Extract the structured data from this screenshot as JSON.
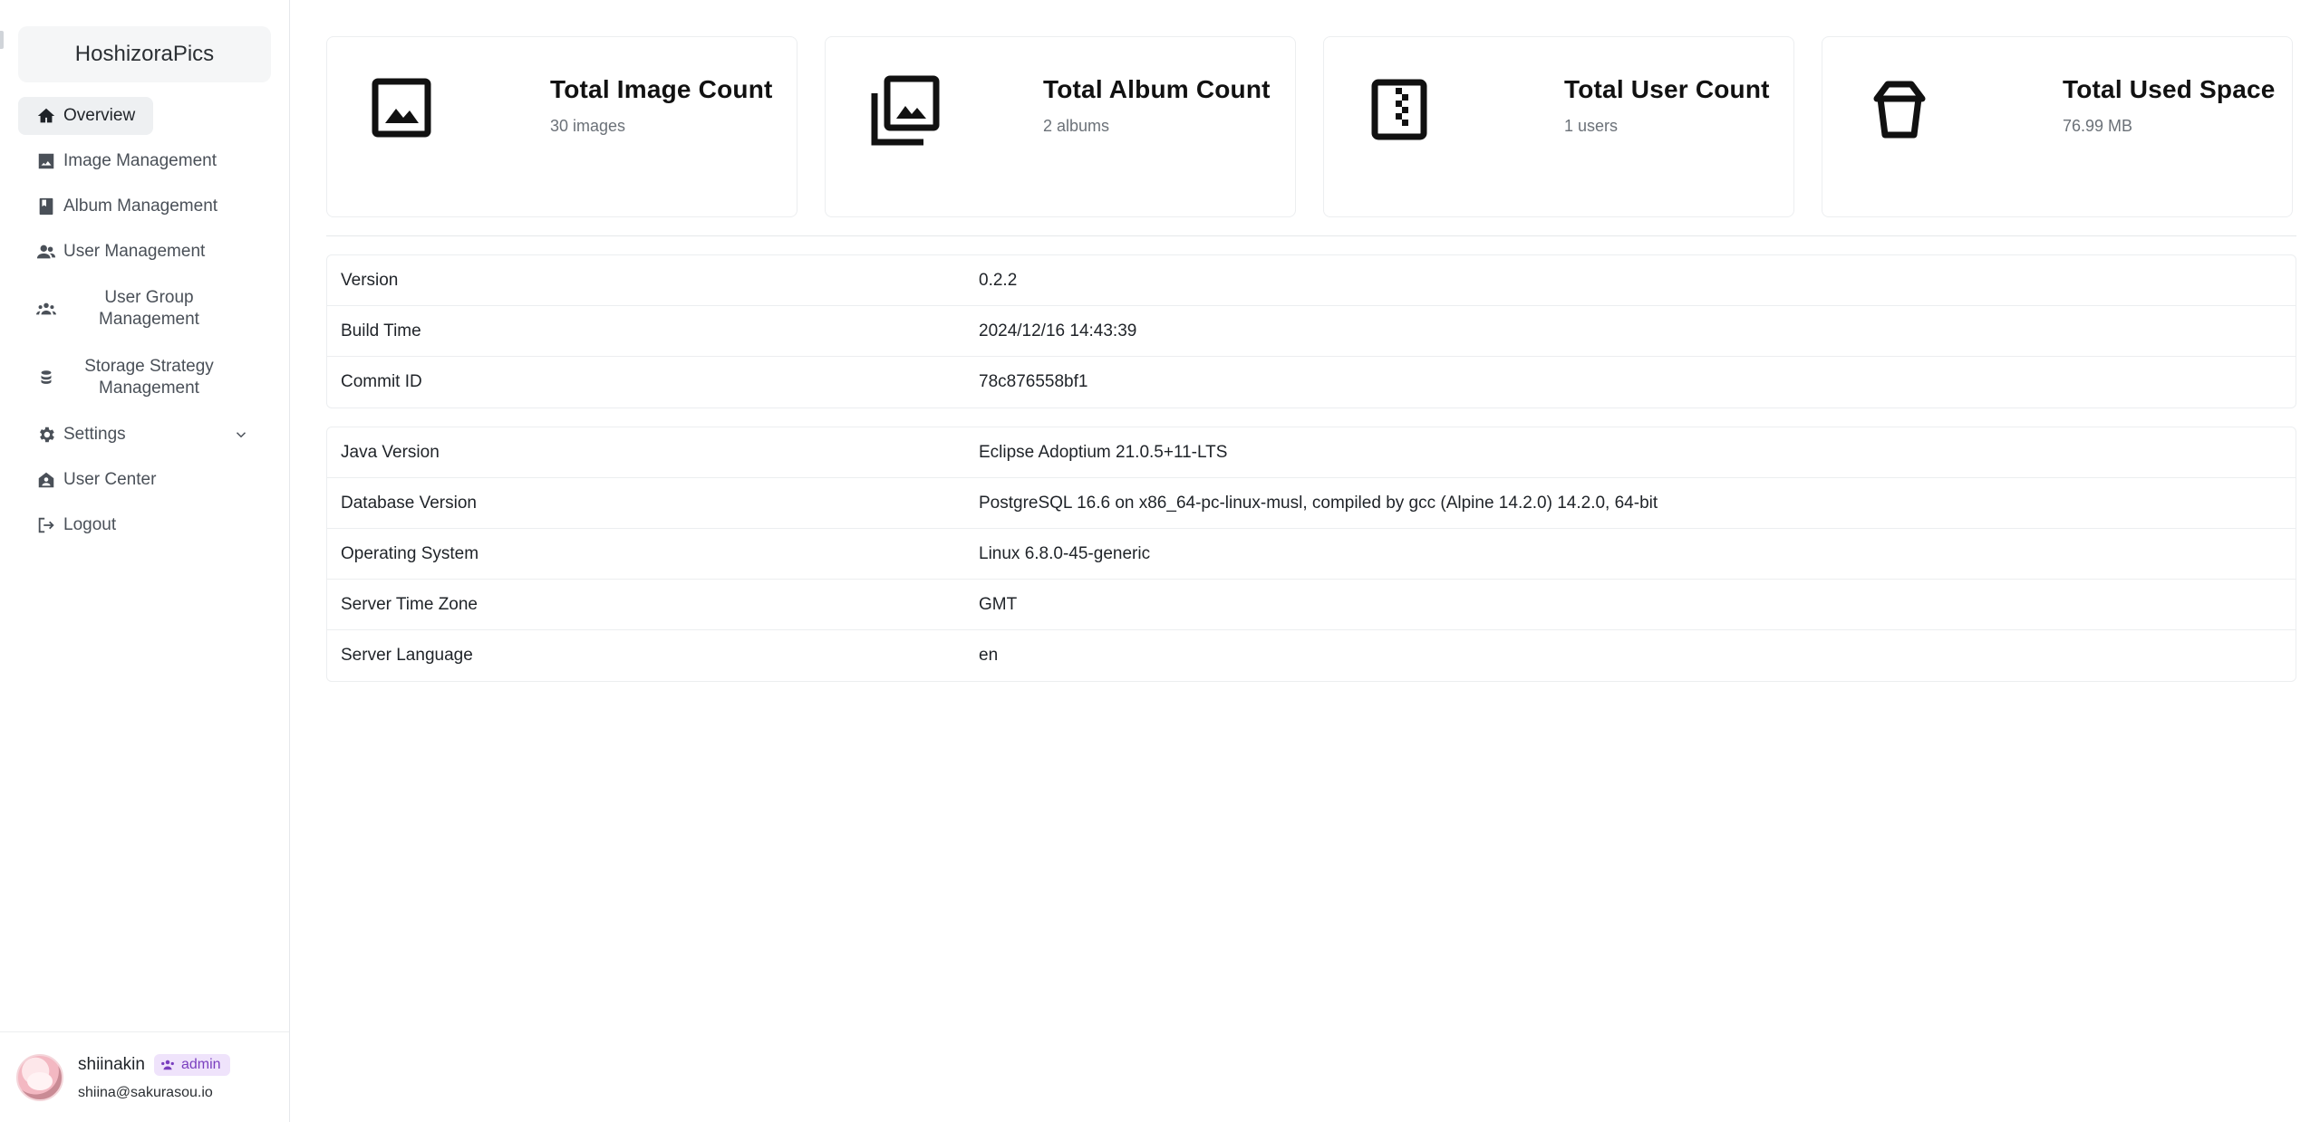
{
  "app": {
    "brand": "HoshizoraPics"
  },
  "sidebar": {
    "items": [
      {
        "label": "Overview",
        "icon": "home-icon",
        "active": true
      },
      {
        "label": "Image Management",
        "icon": "image-icon"
      },
      {
        "label": "Album Management",
        "icon": "album-icon"
      },
      {
        "label": "User Management",
        "icon": "users-icon"
      },
      {
        "label": "User Group\nManagement",
        "icon": "group-icon"
      },
      {
        "label": "Storage Strategy\nManagement",
        "icon": "database-icon"
      },
      {
        "label": "Settings",
        "icon": "gear-icon",
        "expandable": true
      },
      {
        "label": "User Center",
        "icon": "user-home-icon"
      },
      {
        "label": "Logout",
        "icon": "logout-icon"
      }
    ]
  },
  "user": {
    "name": "shiinakin",
    "role": "admin",
    "email": "shiina@sakurasou.io"
  },
  "stats": [
    {
      "title": "Total Image Count",
      "value": "30 images",
      "icon": "image-icon"
    },
    {
      "title": "Total Album Count",
      "value": "2 albums",
      "icon": "photo-library-icon"
    },
    {
      "title": "Total User Count",
      "value": "1 users",
      "icon": "zip-file-icon"
    },
    {
      "title": "Total Used Space",
      "value": "76.99 MB",
      "icon": "bucket-icon"
    }
  ],
  "build_info": [
    {
      "key": "Version",
      "value": "0.2.2"
    },
    {
      "key": "Build Time",
      "value": "2024/12/16 14:43:39"
    },
    {
      "key": "Commit ID",
      "value": "78c876558bf1"
    }
  ],
  "system_info": [
    {
      "key": "Java Version",
      "value": "Eclipse Adoptium 21.0.5+11-LTS"
    },
    {
      "key": "Database Version",
      "value": "PostgreSQL 16.6 on x86_64-pc-linux-musl, compiled by gcc (Alpine 14.2.0) 14.2.0, 64-bit"
    },
    {
      "key": "Operating System",
      "value": "Linux 6.8.0-45-generic"
    },
    {
      "key": "Server Time Zone",
      "value": "GMT"
    },
    {
      "key": "Server Language",
      "value": "en"
    }
  ],
  "colors": {
    "role_badge_bg": "#efe3fb",
    "role_badge_fg": "#7a3fbf",
    "active_nav_bg": "#eef0f2"
  }
}
